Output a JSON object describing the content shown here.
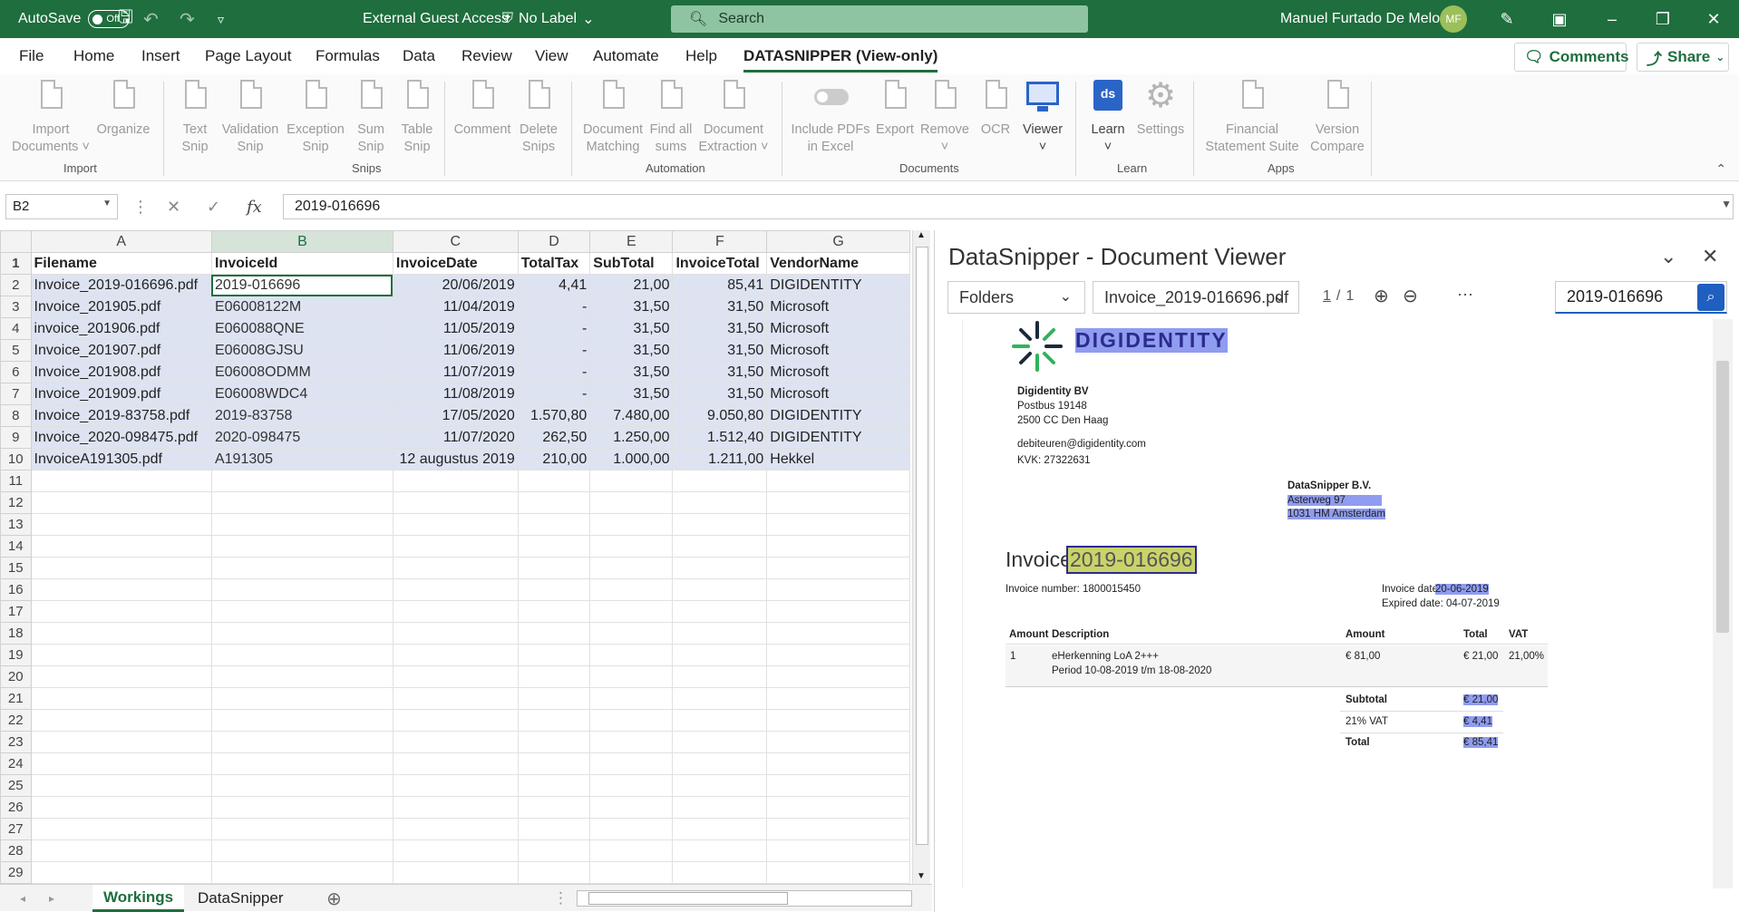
{
  "titlebar": {
    "autosave": "AutoSave",
    "autosave_state": "Off",
    "filename": "External Guest Access",
    "label": "No Label",
    "search": "Search",
    "user": "Manuel Furtado De Melo",
    "initials": "MF"
  },
  "menu": {
    "tabs": [
      "File",
      "Home",
      "Insert",
      "Page Layout",
      "Formulas",
      "Data",
      "Review",
      "View",
      "Automate",
      "Help",
      "DATASNIPPER (View-only)"
    ],
    "comments": "Comments",
    "share": "Share"
  },
  "ribbon": {
    "groups": {
      "import": "Import",
      "snips": "Snips",
      "automation": "Automation",
      "documents": "Documents",
      "learn": "Learn",
      "apps": "Apps"
    },
    "buttons": {
      "import_documents": [
        "Import",
        "Documents ˅"
      ],
      "organize": [
        "Organize",
        ""
      ],
      "text_snip": [
        "Text",
        "Snip"
      ],
      "validation_snip": [
        "Validation",
        "Snip"
      ],
      "exception_snip": [
        "Exception",
        "Snip"
      ],
      "sum_snip": [
        "Sum",
        "Snip"
      ],
      "table_snip": [
        "Table",
        "Snip"
      ],
      "comment": [
        "Comment",
        ""
      ],
      "delete_snips": [
        "Delete",
        "Snips"
      ],
      "document_matching": [
        "Document",
        "Matching"
      ],
      "find_all_sums": [
        "Find all",
        "sums"
      ],
      "document_extraction": [
        "Document",
        "Extraction ˅"
      ],
      "include_pdfs": [
        "Include PDFs",
        "in Excel"
      ],
      "export": [
        "Export",
        ""
      ],
      "remove": [
        "Remove",
        "˅"
      ],
      "ocr": [
        "OCR",
        ""
      ],
      "viewer": [
        "Viewer",
        "˅"
      ],
      "learn": [
        "Learn",
        "˅"
      ],
      "settings": [
        "Settings",
        ""
      ],
      "financial_statement_suite": [
        "Financial",
        "Statement Suite"
      ],
      "version_compare": [
        "Version",
        "Compare"
      ]
    }
  },
  "formula_bar": {
    "namebox": "B2",
    "fx": "fx",
    "value": "2019-016696"
  },
  "sheet": {
    "columns": [
      "A",
      "B",
      "C",
      "D",
      "E",
      "F",
      "G"
    ],
    "header": [
      "Filename",
      "InvoiceId",
      "InvoiceDate",
      "TotalTax",
      "SubTotal",
      "InvoiceTotal",
      "VendorName"
    ],
    "rows": [
      [
        "Invoice_2019-016696.pdf",
        "2019-016696",
        "20/06/2019",
        "4,41",
        "21,00",
        "85,41",
        "DIGIDENTITY"
      ],
      [
        "Invoice_201905.pdf",
        "E06008122M",
        "11/04/2019",
        "-",
        "31,50",
        "31,50",
        " Microsoft"
      ],
      [
        "invoice_201906.pdf",
        "E060088QNE",
        "11/05/2019",
        "-",
        "31,50",
        "31,50",
        "Microsoft"
      ],
      [
        "Invoice_201907.pdf",
        "E06008GJSU",
        "11/06/2019",
        "-",
        "31,50",
        "31,50",
        "Microsoft"
      ],
      [
        "Invoice_201908.pdf",
        "E06008ODMM",
        "11/07/2019",
        "-",
        "31,50",
        "31,50",
        "Microsoft"
      ],
      [
        "Invoice_201909.pdf",
        "E06008WDC4",
        "11/08/2019",
        "-",
        "31,50",
        "31,50",
        "Microsoft"
      ],
      [
        "Invoice_2019-83758.pdf",
        "2019-83758",
        "17/05/2020",
        "1.570,80",
        "7.480,00",
        "9.050,80",
        "DIGIDENTITY"
      ],
      [
        "Invoice_2020-098475.pdf",
        "2020-098475",
        "11/07/2020",
        "262,50",
        "1.250,00",
        "1.512,40",
        " DIGIDENTITY"
      ],
      [
        "InvoiceA191305.pdf",
        "A191305",
        "12 augustus 2019",
        "210,00",
        "1.000,00",
        "1.211,00",
        "Hekkel"
      ]
    ],
    "row_numbers": [
      "1",
      "2",
      "3",
      "4",
      "5",
      "6",
      "7",
      "8",
      "9",
      "10",
      "11",
      "12",
      "13",
      "14",
      "15",
      "16",
      "17",
      "18",
      "19",
      "20",
      "21",
      "22",
      "23",
      "24",
      "25",
      "26",
      "27",
      "28",
      "29"
    ],
    "tabs": [
      "Workings",
      "DataSnipper"
    ]
  },
  "viewer": {
    "title": "DataSnipper - Document Viewer",
    "folders": "Folders",
    "file": "Invoice_2019-016696.pdf",
    "page_current": "1",
    "page_sep": "/",
    "page_total": "1",
    "more": "···",
    "search_value": "2019-016696",
    "doc": {
      "logo": "DIGIDENTITY",
      "sender_name": "Digidentity BV",
      "sender_lines": [
        "Postbus 19148",
        "2500 CC Den Haag"
      ],
      "email": "debiteuren@digidentity.com",
      "kvk": "KVK: 27322631",
      "recipient_name": "DataSnipper B.V.",
      "recipient_lines": [
        "Asterweg 97",
        "1031 HM Amsterdam"
      ],
      "invoice_word": "Invoice",
      "invoice_id": "2019-016696",
      "invoice_number": "Invoice number: 1800015450",
      "invoice_date_label": "Invoice date:",
      "invoice_date": "20-06-2019",
      "expired_date": "Expired date: 04-07-2019",
      "table_headers": [
        "Amount",
        "Description",
        "Amount",
        "Total",
        "VAT"
      ],
      "line": {
        "qty": "1",
        "desc1": "eHerkenning LoA 2+++",
        "desc2": "Period 10-08-2019 t/m 18-08-2020",
        "amount": "€ 81,00",
        "total": "€ 21,00",
        "vat": "21,00%"
      },
      "subtotal_label": "Subtotal",
      "subtotal": "€ 21,00",
      "vat_label": "21% VAT",
      "vat_amount": "€ 4,41",
      "total_label": "Total",
      "total": "€ 85,41"
    }
  },
  "colors": {
    "brand": "#1e6e3e",
    "highlight": "#8f9cf0",
    "selection_fill": "#dde3f1",
    "doc_accent": "#1f5fbf"
  }
}
